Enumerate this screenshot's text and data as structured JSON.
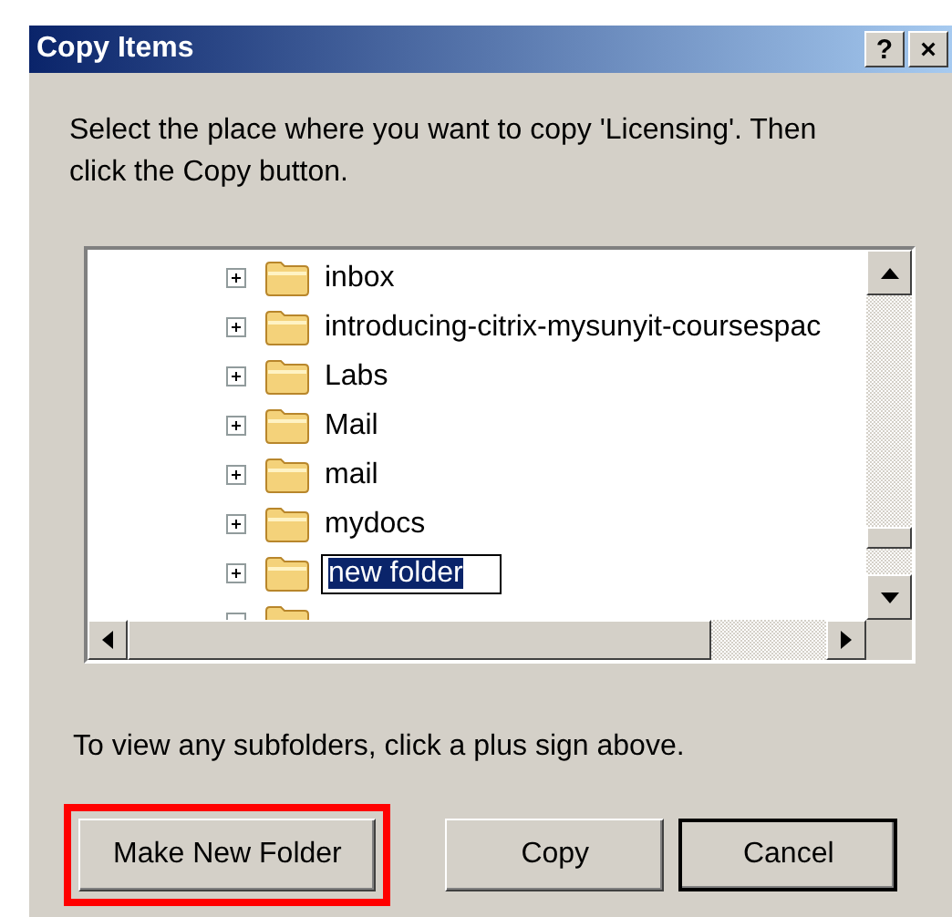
{
  "window": {
    "title": "Copy Items",
    "help_button": "?",
    "close_button": "×"
  },
  "instruction": "Select the place where you want to copy 'Licensing'. Then click the Copy button.",
  "tree": {
    "items": [
      {
        "label": "inbox",
        "expandable": true,
        "editing": false
      },
      {
        "label": "introducing-citrix-mysunyit-coursespac",
        "expandable": true,
        "editing": false
      },
      {
        "label": "Labs",
        "expandable": true,
        "editing": false
      },
      {
        "label": "Mail",
        "expandable": true,
        "editing": false
      },
      {
        "label": "mail",
        "expandable": true,
        "editing": false
      },
      {
        "label": "mydocs",
        "expandable": true,
        "editing": false
      },
      {
        "label": "new folder",
        "expandable": true,
        "editing": true
      }
    ]
  },
  "hint": "To view any subfolders, click a plus sign above.",
  "buttons": [
    {
      "label": "Make New Folder",
      "highlighted": true,
      "default": false
    },
    {
      "label": "Copy",
      "highlighted": false,
      "default": false
    },
    {
      "label": "Cancel",
      "highlighted": false,
      "default": true
    }
  ]
}
